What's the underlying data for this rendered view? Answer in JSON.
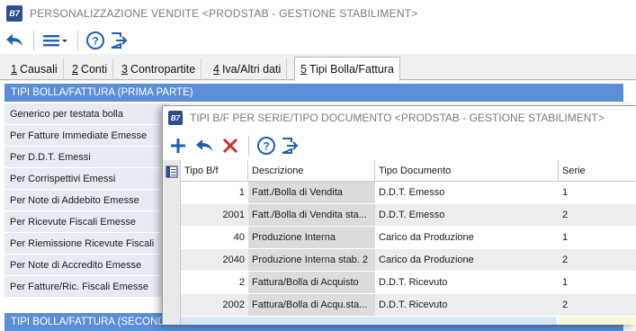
{
  "window": {
    "logo_text": "B7",
    "title": "PERSONALIZZAZIONE VENDITE <PRODSTAB - GESTIONE STABILIMENT>"
  },
  "toolbar": {
    "icons": [
      "back-arrow-icon",
      "menu-icon",
      "help-icon",
      "exit-icon"
    ]
  },
  "tabs": [
    {
      "key": "1",
      "label": "Causali"
    },
    {
      "key": "2",
      "label": "Conti"
    },
    {
      "key": "3",
      "label": "Contropartite"
    },
    {
      "key": "4",
      "label": "Iva/Altri dati"
    },
    {
      "key": "5",
      "label": "Tipi Bolla/Fattura"
    }
  ],
  "section1": {
    "header": "TIPI BOLLA/FATTURA (PRIMA PARTE)",
    "items": [
      "Generico per testata bolla",
      "Per Fatture Immediate Emesse",
      "Per D.D.T. Emessi",
      "Per Corrispettivi Emessi",
      "Per Note di Addebito Emesse",
      "Per Ricevute Fiscali Emesse",
      "Per Riemissione Ricevute Fiscali",
      "Per Note di Accredito Emesse",
      "Per Fatture/Ric. Fiscali Emesse"
    ]
  },
  "section2": {
    "header": "TIPI BOLLA/FATTURA (SECONDA P"
  },
  "dialog": {
    "logo_text": "B7",
    "title": "TIPI B/F PER SERIE/TIPO DOCUMENTO <PRODSTAB - GESTIONE STABILIMENT>",
    "toolbar_icons": [
      "add-icon",
      "undo-icon",
      "delete-icon",
      "help-icon",
      "exit-icon"
    ],
    "columns": [
      "Tipo B/f",
      "Descrizione",
      "Tipo Documento",
      "Serie"
    ],
    "rows": [
      {
        "tipo": "1",
        "descrizione": "Fatt./Bolla di Vendita",
        "tipo_documento": "D.D.T. Emesso",
        "serie": "1"
      },
      {
        "tipo": "2001",
        "descrizione": "Fatt./Bolla di Vendita sta...",
        "tipo_documento": "D.D.T. Emesso",
        "serie": "2"
      },
      {
        "tipo": "40",
        "descrizione": "Produzione Interna",
        "tipo_documento": "Carico da Produzione",
        "serie": "1"
      },
      {
        "tipo": "2040",
        "descrizione": "Produzione Interna stab. 2",
        "tipo_documento": "Carico da Produzione",
        "serie": "2"
      },
      {
        "tipo": "2",
        "descrizione": "Fattura/Bolla di Acquisto",
        "tipo_documento": "D.D.T. Ricevuto",
        "serie": "1"
      },
      {
        "tipo": "2002",
        "descrizione": "Fattura/Bolla di Acqu.sta...",
        "tipo_documento": "D.D.T. Ricevuto",
        "serie": "2"
      }
    ]
  },
  "colors": {
    "section_header": "#5b8ed6",
    "list_item_bg": "#e7ecf3",
    "accent_blue": "#1f5fb4",
    "delete_red": "#d32f2f"
  }
}
